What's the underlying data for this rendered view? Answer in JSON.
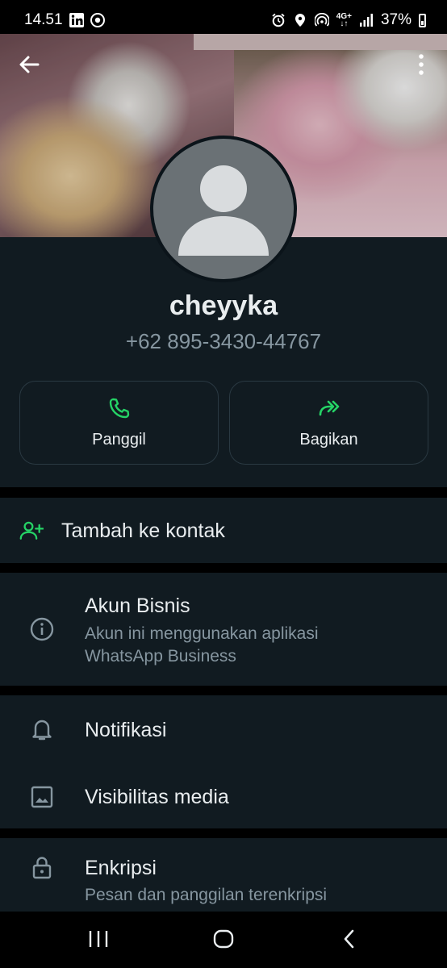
{
  "status_bar": {
    "time": "14.51",
    "network": "4G+",
    "battery_percent": "37%"
  },
  "header": {
    "back_icon": "arrow-left-icon",
    "menu_icon": "more-vertical-icon"
  },
  "profile": {
    "name": "cheyyka",
    "phone": "+62 895-3430-44767",
    "actions": [
      {
        "label": "Panggil",
        "icon": "phone-icon"
      },
      {
        "label": "Bagikan",
        "icon": "share-forward-icon"
      }
    ]
  },
  "add_contact": {
    "label": "Tambah ke kontak",
    "icon": "person-add-icon"
  },
  "business": {
    "title": "Akun Bisnis",
    "subtitle_line1": "Akun ini menggunakan aplikasi",
    "subtitle_line2": "WhatsApp Business",
    "icon": "info-icon"
  },
  "settings": {
    "notifications": "Notifikasi",
    "media_visibility": "Visibilitas media"
  },
  "encryption": {
    "title": "Enkripsi",
    "subtitle": "Pesan dan panggilan terenkripsi"
  },
  "colors": {
    "accent": "#25d366",
    "background": "#0b141a",
    "card": "#111b21",
    "muted_text": "#8696a0"
  }
}
